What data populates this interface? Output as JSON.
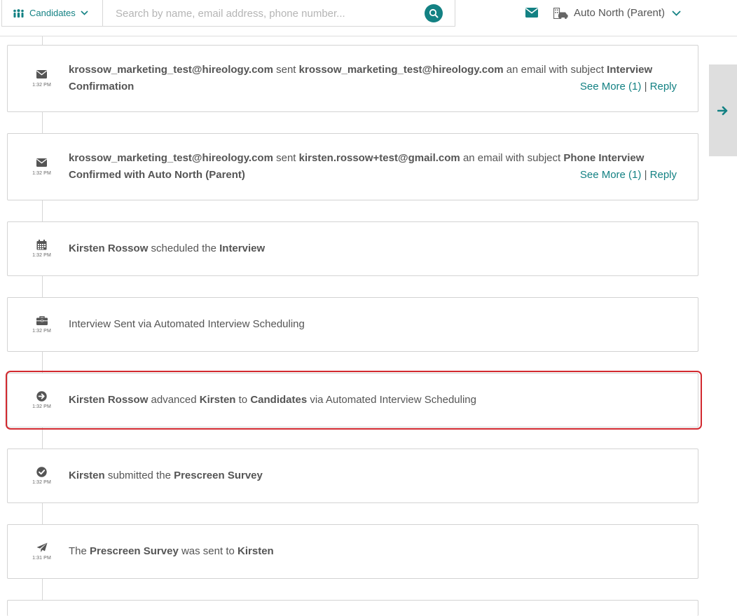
{
  "header": {
    "scope_label": "Candidates",
    "search_placeholder": "Search by name, email address, phone number...",
    "org_label": "Auto North (Parent)"
  },
  "colors": {
    "accent": "#138183",
    "highlight": "#d2292f"
  },
  "timeline": [
    {
      "icon": "envelope-icon",
      "time": "1:32 PM",
      "line1": {
        "sender": "krossow_marketing_test@hireology.com",
        "verb": "sent",
        "recipient": "krossow_marketing_test@hireology.com",
        "middle": "an email with subject",
        "subject_start": "Interview"
      },
      "line2": {
        "subject_end": "Confirmation"
      },
      "see_more": "See More (1)",
      "separator": "|",
      "reply": "Reply"
    },
    {
      "icon": "envelope-icon",
      "time": "1:32 PM",
      "line1": {
        "sender": "krossow_marketing_test@hireology.com",
        "verb": "sent",
        "recipient": "kirsten.rossow+test@gmail.com",
        "middle": "an email with subject",
        "subject_start": "Phone Interview"
      },
      "line2": {
        "subject_end": "Confirmed with Auto North (Parent)"
      },
      "see_more": "See More (1)",
      "separator": "|",
      "reply": "Reply"
    },
    {
      "icon": "calendar-icon",
      "time": "1:32 PM",
      "actor": "Kirsten Rossow",
      "verb": "scheduled the",
      "object": "Interview"
    },
    {
      "icon": "briefcase-icon",
      "time": "1:32 PM",
      "text": "Interview Sent via Automated Interview Scheduling"
    },
    {
      "icon": "arrow-circle-right-icon",
      "time": "1:32 PM",
      "actor": "Kirsten Rossow",
      "verb": "advanced",
      "subject": "Kirsten",
      "to": "to",
      "stage": "Candidates",
      "via": "via Automated Interview Scheduling"
    },
    {
      "icon": "check-circle-icon",
      "time": "1:32 PM",
      "actor": "Kirsten",
      "verb": "submitted the",
      "object": "Prescreen Survey"
    },
    {
      "icon": "paper-plane-icon",
      "time": "1:31 PM",
      "lead": "The",
      "object": "Prescreen Survey",
      "verb": "was sent to",
      "recipient": "Kirsten"
    }
  ]
}
